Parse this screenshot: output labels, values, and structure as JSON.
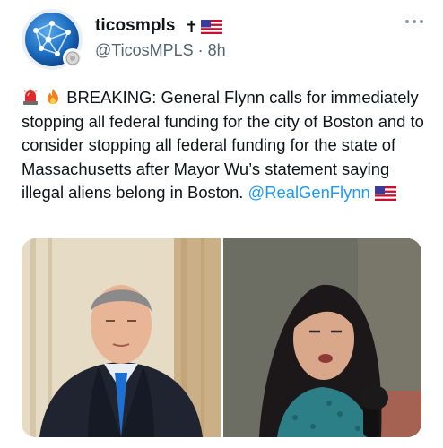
{
  "tweet": {
    "display_name": "ticosmpls",
    "name_emojis": [
      "latin-cross",
      "us-flag"
    ],
    "handle": "@TicosMPLS",
    "separator": "·",
    "timestamp": "8h",
    "body_prefix_icons": [
      "police-light-emoji",
      "fire-emoji"
    ],
    "body_text": "BREAKING: General Flynn calls for immediately stopping all federal funding for the city of Boston and to consider stopping all federal funding for the state of Massachusetts after Mayor Wu’s statement saying illegal aliens belong in Boston.",
    "mention": "@RealGenFlynn",
    "body_suffix_icon": "us-flag-emoji",
    "media": [
      {
        "subject": "man-in-suit-photo"
      },
      {
        "subject": "woman-speaking-at-microphone-photo"
      }
    ]
  },
  "colors": {
    "text": "#0f1419",
    "secondary_text": "#536471",
    "link": "#1d9bf0",
    "background": "#ffffff"
  }
}
